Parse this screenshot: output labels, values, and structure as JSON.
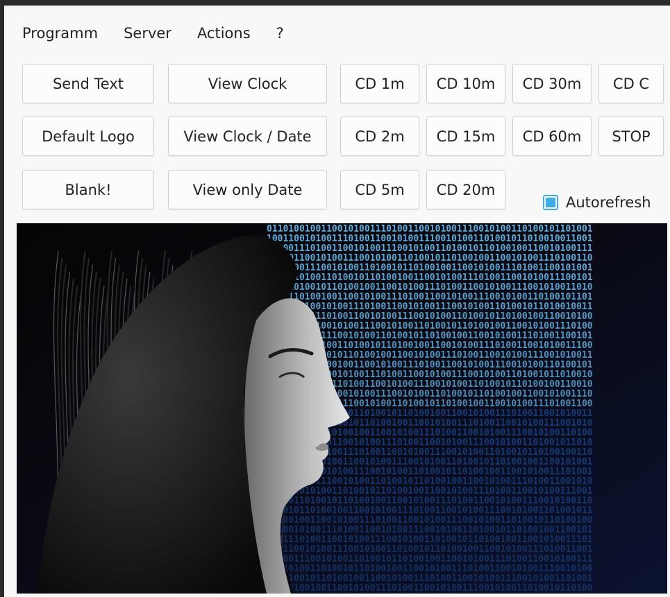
{
  "menu": [
    "Programm",
    "Server",
    "Actions",
    "?"
  ],
  "buttons": {
    "send_text": "Send Text",
    "view_clock": "View Clock",
    "cd_1m": "CD 1m",
    "cd_10m": "CD 10m",
    "cd_30m": "CD 30m",
    "cd_c": "CD C",
    "default_logo": "Default Logo",
    "view_clock_date": "View Clock / Date",
    "cd_2m": "CD 2m",
    "cd_15m": "CD 15m",
    "cd_60m": "CD 60m",
    "stop": "STOP",
    "blank": "Blank!",
    "view_only_date": "View only Date",
    "cd_5m": "CD 5m",
    "cd_20m": "CD 20m"
  },
  "autorefresh": {
    "label": "Autorefresh",
    "checked": true
  },
  "preview": {
    "icon": "preview-image",
    "binary_digits": "0110100100110010100111010011001010011100101001101001"
  },
  "colors": {
    "accent": "#3daee9",
    "binary_light": "#62b8e9",
    "binary_dark": "#1a4f9c"
  }
}
